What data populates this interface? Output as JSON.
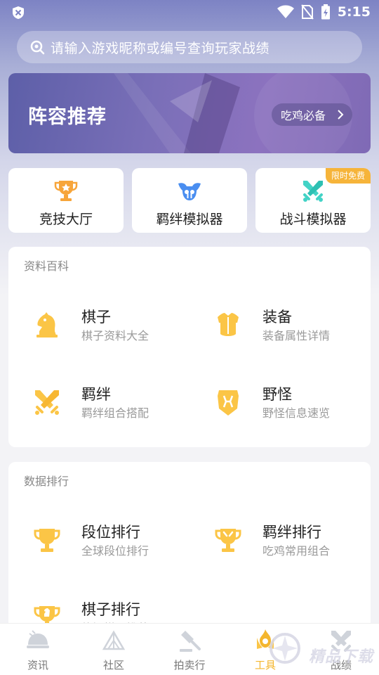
{
  "status_bar": {
    "time": "5:15"
  },
  "search": {
    "placeholder": "请输入游戏昵称或编号查询玩家战绩"
  },
  "banner": {
    "title": "阵容推荐",
    "link_label": "吃鸡必备"
  },
  "quick_cards": [
    {
      "label": "竞技大厅",
      "icon": "trophy-icon"
    },
    {
      "label": "羁绊模拟器",
      "icon": "bond-simulator-icon"
    },
    {
      "label": "战斗模拟器",
      "icon": "crossed-swords-icon",
      "badge": "限时免费"
    }
  ],
  "encyclopedia": {
    "title": "资料百科",
    "items": [
      {
        "title": "棋子",
        "subtitle": "棋子资料大全",
        "icon": "chess-knight-icon"
      },
      {
        "title": "装备",
        "subtitle": "装备属性详情",
        "icon": "armor-icon"
      },
      {
        "title": "羁绊",
        "subtitle": "羁绊组合搭配",
        "icon": "crossed-swords-icon"
      },
      {
        "title": "野怪",
        "subtitle": "野怪信息速览",
        "icon": "monster-icon"
      }
    ]
  },
  "rankings": {
    "title": "数据排行",
    "items": [
      {
        "title": "段位排行",
        "subtitle": "全球段位排行",
        "icon": "trophy-icon"
      },
      {
        "title": "羁绊排行",
        "subtitle": "吃鸡常用组合",
        "icon": "trophy-icon"
      },
      {
        "title": "棋子排行",
        "subtitle": "热门棋子推荐",
        "icon": "trophy-icon"
      }
    ]
  },
  "tabs": [
    {
      "label": "资讯",
      "icon": "news-icon"
    },
    {
      "label": "社区",
      "icon": "community-icon"
    },
    {
      "label": "拍卖行",
      "icon": "auction-icon"
    },
    {
      "label": "工具",
      "icon": "tools-icon",
      "active": true
    },
    {
      "label": "战绩",
      "icon": "record-icon"
    }
  ],
  "colors": {
    "accent": "#f4b62e",
    "icon_yellow": "#fbc546",
    "banner": "#7a6fb8",
    "badge": "#f6b43a"
  }
}
